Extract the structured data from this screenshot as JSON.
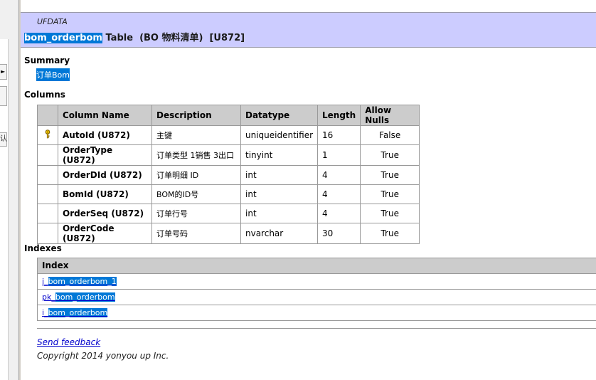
{
  "left_pane": {
    "arrow_icon": "right-arrow",
    "side_char": "认"
  },
  "header": {
    "db_name": "UFDATA",
    "table_name": "bom_orderbom",
    "title_rest": " Table  (BO 物料清单)  [U872]"
  },
  "summary": {
    "heading": "Summary",
    "text": "订单Bom"
  },
  "columns": {
    "heading": "Columns",
    "headers": [
      "",
      "Column Name",
      "Description",
      "Datatype",
      "Length",
      "Allow Nulls"
    ],
    "rows": [
      {
        "icon": "key-icon",
        "name": "AutoId (U872)",
        "description": "主键",
        "datatype": "uniqueidentifier",
        "length": "16",
        "nulls": "False"
      },
      {
        "icon": "",
        "name": "OrderType (U872)",
        "description": "订单类型 1销售 3出口",
        "datatype": "tinyint",
        "length": "1",
        "nulls": "True"
      },
      {
        "icon": "",
        "name": "OrderDId (U872)",
        "description": "订单明细 ID",
        "datatype": "int",
        "length": "4",
        "nulls": "True"
      },
      {
        "icon": "",
        "name": "BomId (U872)",
        "description": "BOM的ID号",
        "datatype": "int",
        "length": "4",
        "nulls": "True"
      },
      {
        "icon": "",
        "name": "OrderSeq (U872)",
        "description": "订单行号",
        "datatype": "int",
        "length": "4",
        "nulls": "True"
      },
      {
        "icon": "",
        "name": "OrderCode (U872)",
        "description": "订单号码",
        "datatype": "nvarchar",
        "length": "30",
        "nulls": "True"
      }
    ]
  },
  "indexes": {
    "heading": "Indexes",
    "header": "Index",
    "rows": [
      {
        "prefix": "i_",
        "highlight": "bom_orderbom_1"
      },
      {
        "prefix": "pk_",
        "highlight": "bom_orderbom"
      },
      {
        "prefix": "i_",
        "highlight": "bom_orderbom"
      }
    ]
  },
  "footer": {
    "feedback": "Send feedback",
    "copyright": "Copyright 2014 yonyou up Inc."
  },
  "colors": {
    "header_bg": "#ccccff",
    "selection": "#0078d7",
    "link": "#0000cc"
  }
}
